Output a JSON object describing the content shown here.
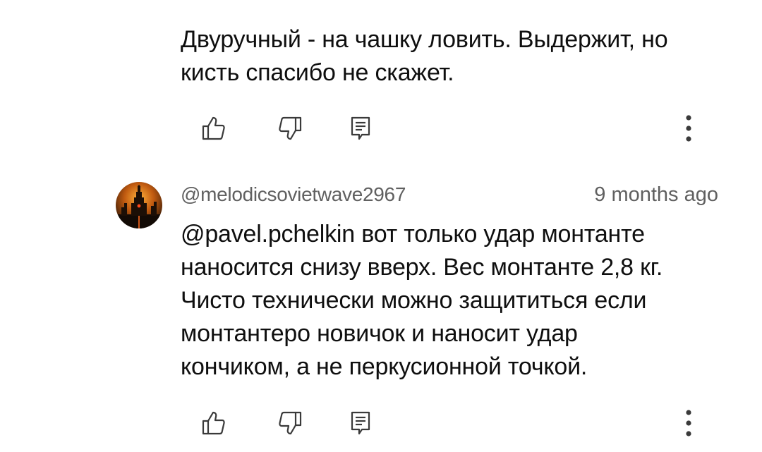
{
  "comments": [
    {
      "text": "Двуручный - на чашку ловить. Выдержит, но\nкисть спасибо не скажет.",
      "actions": {
        "like_icon": "thumb-up-icon",
        "dislike_icon": "thumb-down-icon",
        "reply_icon": "reply-comment-icon",
        "more_icon": "more-vert-icon"
      }
    },
    {
      "author": "@melodicsovietwave2967",
      "timestamp": "9 months ago",
      "text": "@pavel.pchelkin вот только удар монтанте\nнаносится снизу вверх. Вес монтанте 2,8 кг.\nЧисто технически можно защититься если\nмонтантеро новичок и наносит удар\nкончиком, а не перкусионной точкой.",
      "actions": {
        "like_icon": "thumb-up-icon",
        "dislike_icon": "thumb-down-icon",
        "reply_icon": "reply-comment-icon",
        "more_icon": "more-vert-icon"
      }
    }
  ],
  "colors": {
    "text": "#0f0f0f",
    "secondary": "#606060",
    "icon": "#3a3a3a",
    "background": "#ffffff"
  }
}
